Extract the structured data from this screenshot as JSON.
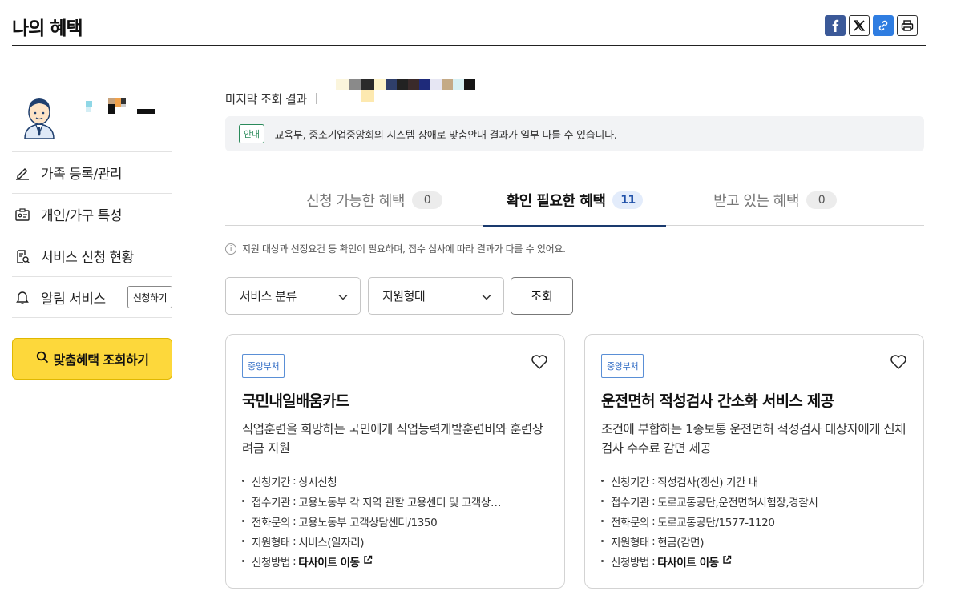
{
  "header": {
    "title": "나의 혜택",
    "share": [
      {
        "icon": "facebook-icon"
      },
      {
        "icon": "x-twitter-icon"
      },
      {
        "icon": "link-icon"
      },
      {
        "icon": "print-icon"
      }
    ]
  },
  "sidebar": {
    "menu": [
      {
        "label": "가족 등록/관리",
        "icon": "pencil-icon"
      },
      {
        "label": "개인/가구 특성",
        "icon": "id-card-icon"
      },
      {
        "label": "서비스 신청 현황",
        "icon": "document-search-icon"
      },
      {
        "label": "알림 서비스",
        "icon": "bell-icon",
        "button": "신청하기"
      }
    ],
    "cta_label": "맞춤혜택 조회하기"
  },
  "main": {
    "last_query_label": "마지막 조회 결과",
    "notice": {
      "badge": "안내",
      "text": "교육부, 중소기업중앙회의 시스템 장애로 맞춤안내 결과가 일부 다를 수 있습니다."
    },
    "tabs": [
      {
        "label": "신청 가능한 혜택",
        "count": "0"
      },
      {
        "label": "확인 필요한 혜택",
        "count": "11",
        "active": true
      },
      {
        "label": "받고 있는 혜택",
        "count": "0"
      }
    ],
    "info_text": "지원 대상과 선정요건 등 확인이 필요하며, 접수 심사에 따라 결과가 다를 수 있어요.",
    "filters": [
      {
        "label": "서비스 분류"
      },
      {
        "label": "지원형태"
      }
    ],
    "search_button": "조회",
    "cards": [
      {
        "badge": "중앙부처",
        "title": "국민내일배움카드",
        "desc": "직업훈련을 희망하는 국민에게 직업능력개발훈련비와 훈련장려금 지원",
        "details": [
          {
            "key": "신청기간",
            "value": "상시신청"
          },
          {
            "key": "접수기관",
            "value": "고용노동부 각 지역 관할 고용센터 및 고객상…"
          },
          {
            "key": "전화문의",
            "value": "고용노동부 고객상담센터/1350"
          },
          {
            "key": "지원형태",
            "value": "서비스(일자리)"
          },
          {
            "key": "신청방법",
            "value": "타사이트 이동"
          }
        ]
      },
      {
        "badge": "중앙부처",
        "title": "운전면허 적성검사 간소화 서비스 제공",
        "desc": "조건에 부합하는 1종보통 운전면허 적성검사 대상자에게 신체검사 수수료 감면 제공",
        "details": [
          {
            "key": "신청기간",
            "value": "적성검사(갱신) 기간 내"
          },
          {
            "key": "접수기관",
            "value": "도로교통공단,운전면허시험장,경찰서"
          },
          {
            "key": "전화문의",
            "value": "도로교통공단/1577-1120"
          },
          {
            "key": "지원형태",
            "value": "현금(감면)"
          },
          {
            "key": "신청방법",
            "value": "타사이트 이동"
          }
        ]
      }
    ]
  },
  "colors": {
    "accent_yellow": "#fdd83b",
    "tab_active_underline": "#1a3a6e",
    "badge_green": "#2a8a5a",
    "badge_blue": "#2e6ac4"
  }
}
